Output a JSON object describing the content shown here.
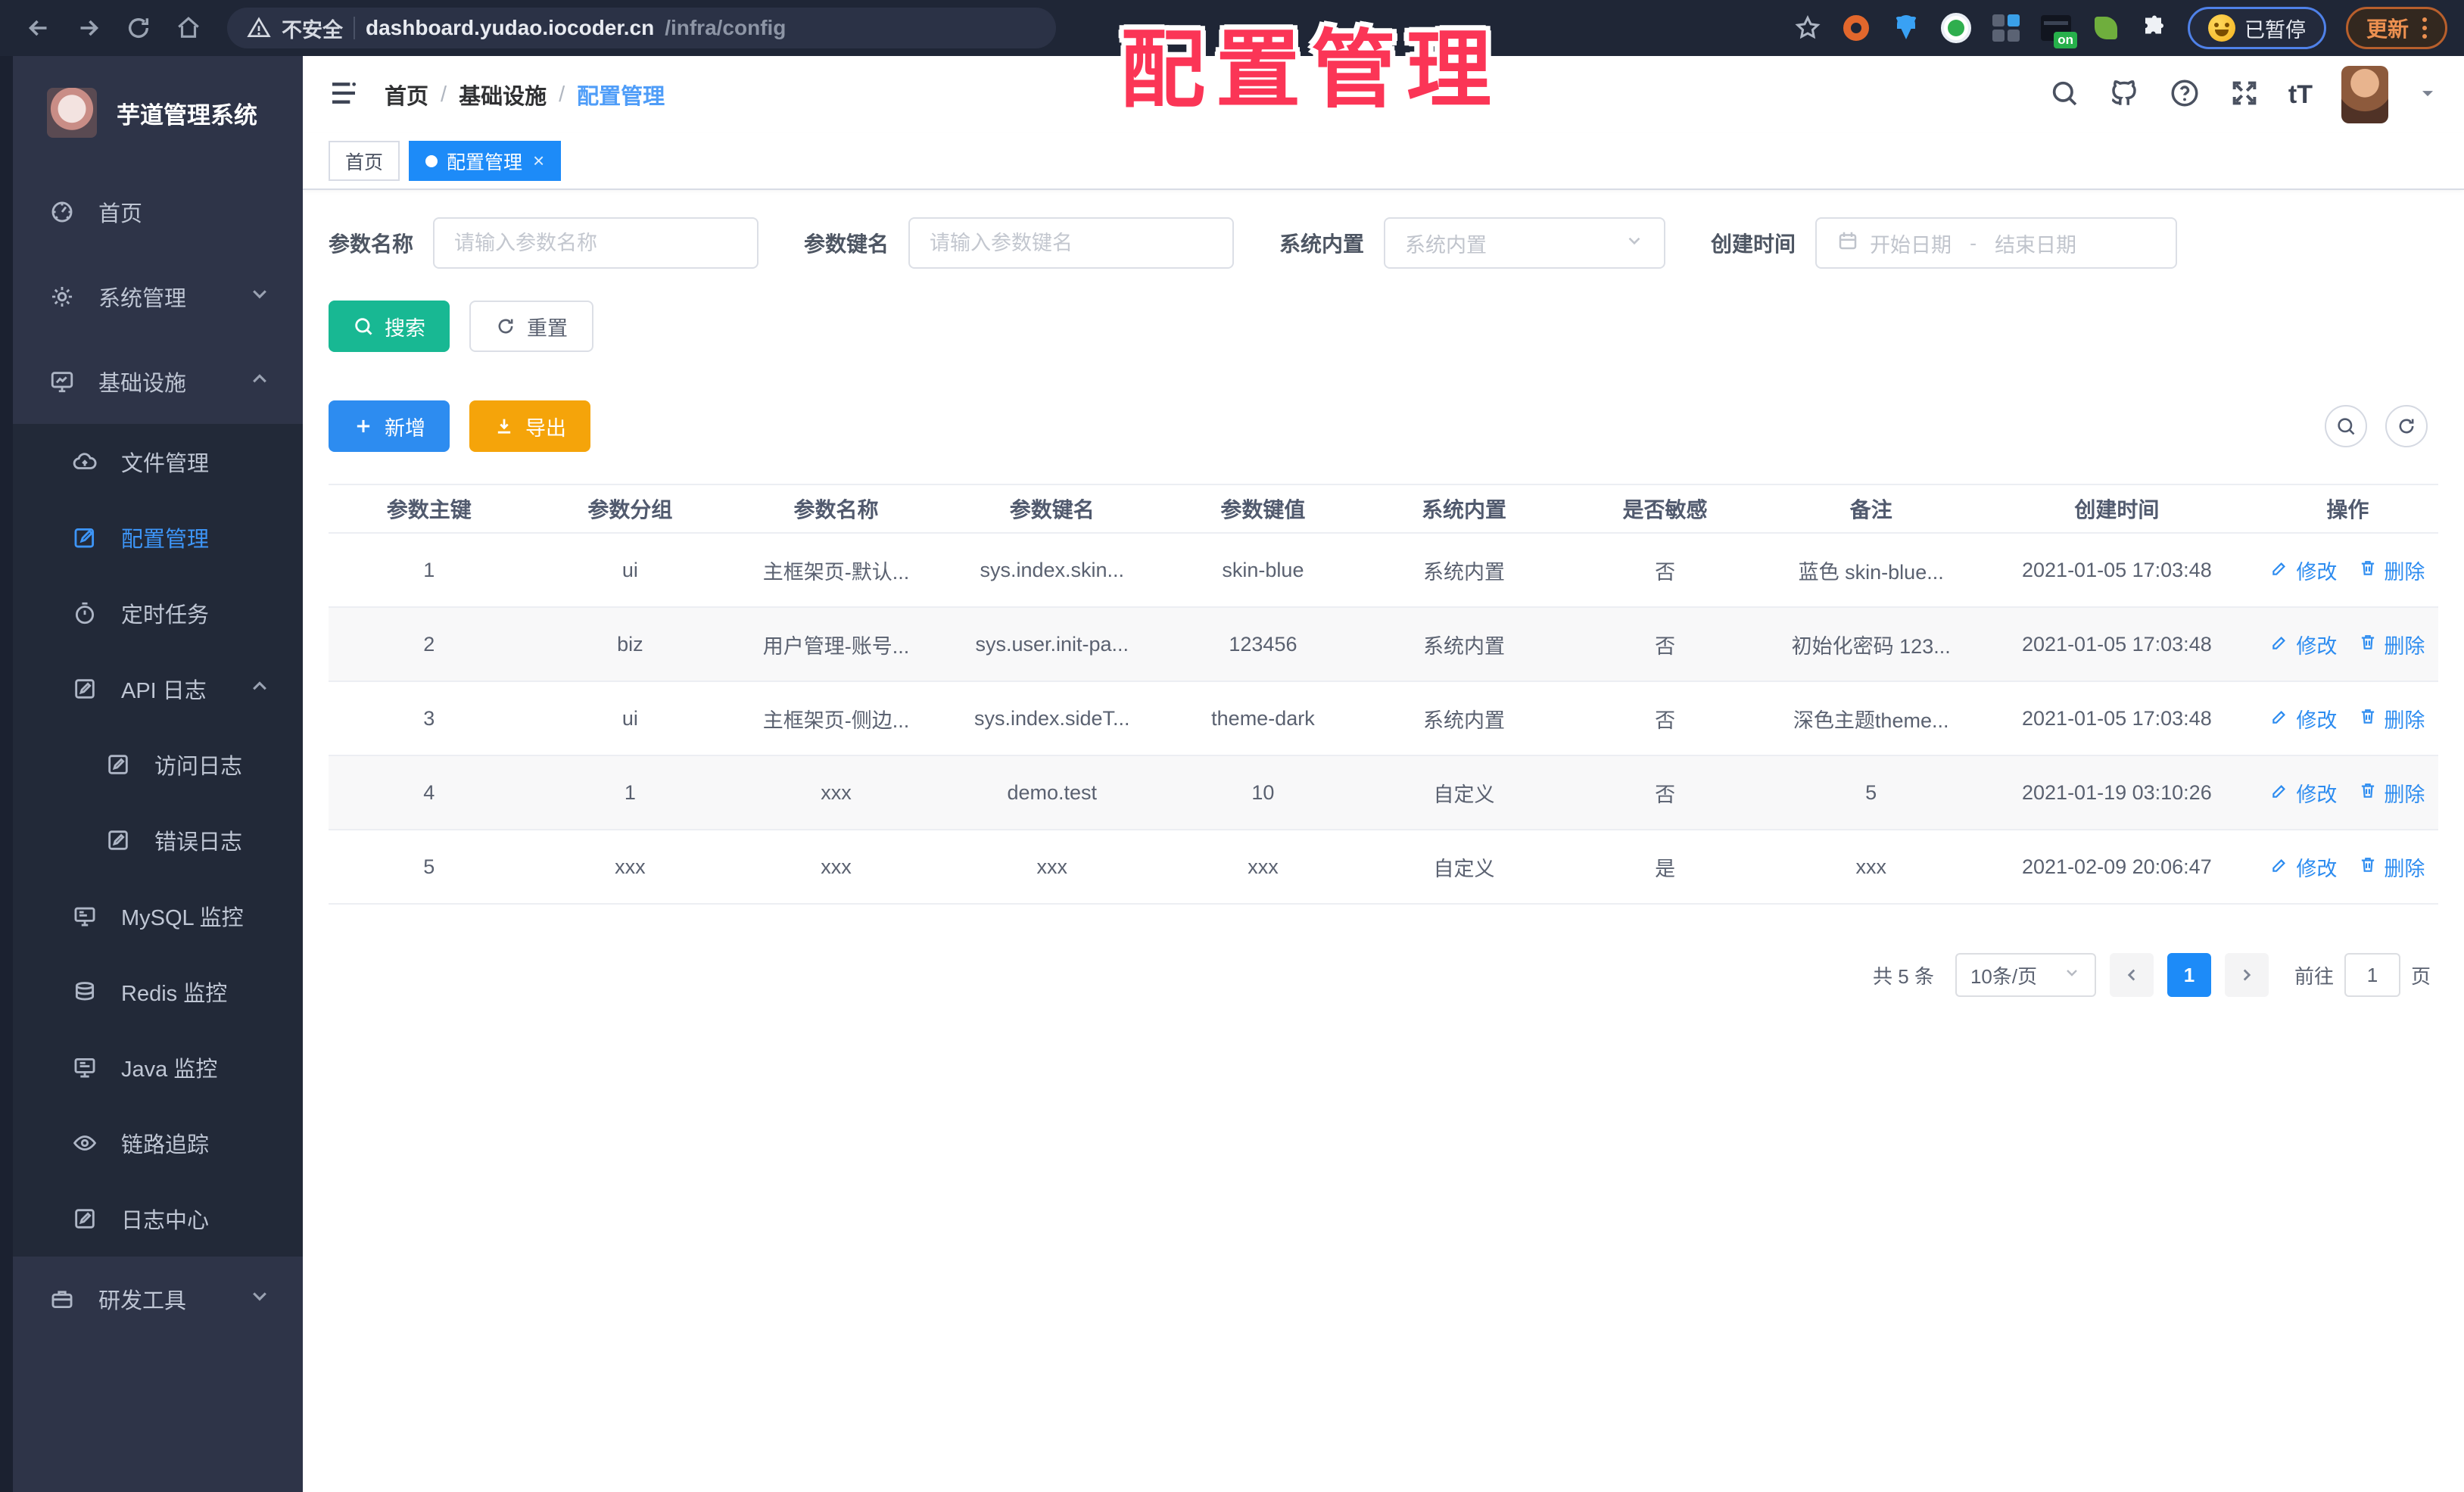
{
  "overlay": {
    "title": "配置管理"
  },
  "browser": {
    "security_label": "不安全",
    "url_host": "dashboard.yudao.iocoder.cn",
    "url_path": "/infra/config",
    "paused_label": "已暂停",
    "update_label": "更新",
    "extension_on_badge": "on"
  },
  "sidebar": {
    "logo_title": "芋道管理系统",
    "menu": [
      {
        "label": "首页",
        "icon": "dashboard-icon",
        "level": 1,
        "active": false,
        "chevron": null,
        "sub": false
      },
      {
        "label": "系统管理",
        "icon": "gear-icon",
        "level": 1,
        "active": false,
        "chevron": "down",
        "sub": false
      },
      {
        "label": "基础设施",
        "icon": "infra-icon",
        "level": 1,
        "active": false,
        "chevron": "up",
        "sub": false
      },
      {
        "label": "文件管理",
        "icon": "cloud-icon",
        "level": 2,
        "active": false,
        "chevron": null,
        "sub": true
      },
      {
        "label": "配置管理",
        "icon": "edit-icon",
        "level": 2,
        "active": true,
        "chevron": null,
        "sub": true
      },
      {
        "label": "定时任务",
        "icon": "timer-icon",
        "level": 2,
        "active": false,
        "chevron": null,
        "sub": true
      },
      {
        "label": "API 日志",
        "icon": "log-icon",
        "level": 2,
        "active": false,
        "chevron": "up",
        "sub": true
      },
      {
        "label": "访问日志",
        "icon": "log-icon",
        "level": 3,
        "active": false,
        "chevron": null,
        "sub": true
      },
      {
        "label": "错误日志",
        "icon": "log-icon",
        "level": 3,
        "active": false,
        "chevron": null,
        "sub": true
      },
      {
        "label": "MySQL 监控",
        "icon": "mysql-icon",
        "level": 2,
        "active": false,
        "chevron": null,
        "sub": true
      },
      {
        "label": "Redis 监控",
        "icon": "redis-icon",
        "level": 2,
        "active": false,
        "chevron": null,
        "sub": true
      },
      {
        "label": "Java 监控",
        "icon": "java-icon",
        "level": 2,
        "active": false,
        "chevron": null,
        "sub": true
      },
      {
        "label": "链路追踪",
        "icon": "eye-icon",
        "level": 2,
        "active": false,
        "chevron": null,
        "sub": true
      },
      {
        "label": "日志中心",
        "icon": "log-icon",
        "level": 2,
        "active": false,
        "chevron": null,
        "sub": true
      },
      {
        "label": "研发工具",
        "icon": "tools-icon",
        "level": 1,
        "active": false,
        "chevron": "down",
        "sub": false
      }
    ]
  },
  "header": {
    "breadcrumb": [
      "首页",
      "基础设施",
      "配置管理"
    ]
  },
  "tags": [
    {
      "label": "首页",
      "active": false,
      "closable": false
    },
    {
      "label": "配置管理",
      "active": true,
      "closable": true
    }
  ],
  "filters": {
    "name_label": "参数名称",
    "name_placeholder": "请输入参数名称",
    "key_label": "参数键名",
    "key_placeholder": "请输入参数键名",
    "type_label": "系统内置",
    "type_placeholder": "系统内置",
    "date_label": "创建时间",
    "date_start_placeholder": "开始日期",
    "date_separator": "-",
    "date_end_placeholder": "结束日期",
    "search_label": "搜索",
    "reset_label": "重置"
  },
  "toolbar": {
    "add_label": "新增",
    "export_label": "导出"
  },
  "table": {
    "columns": [
      "参数主键",
      "参数分组",
      "参数名称",
      "参数键名",
      "参数键值",
      "系统内置",
      "是否敏感",
      "备注",
      "创建时间",
      "操作"
    ],
    "edit_label": "修改",
    "delete_label": "删除",
    "rows": [
      {
        "id": "1",
        "group": "ui",
        "name": "主框架页-默认...",
        "key": "sys.index.skin...",
        "value": "skin-blue",
        "type": "系统内置",
        "sensitive": "否",
        "remark": "蓝色 skin-blue...",
        "created": "2021-01-05 17:03:48"
      },
      {
        "id": "2",
        "group": "biz",
        "name": "用户管理-账号...",
        "key": "sys.user.init-pa...",
        "value": "123456",
        "type": "系统内置",
        "sensitive": "否",
        "remark": "初始化密码 123...",
        "created": "2021-01-05 17:03:48"
      },
      {
        "id": "3",
        "group": "ui",
        "name": "主框架页-侧边...",
        "key": "sys.index.sideT...",
        "value": "theme-dark",
        "type": "系统内置",
        "sensitive": "否",
        "remark": "深色主题theme...",
        "created": "2021-01-05 17:03:48"
      },
      {
        "id": "4",
        "group": "1",
        "name": "xxx",
        "key": "demo.test",
        "value": "10",
        "type": "自定义",
        "sensitive": "否",
        "remark": "5",
        "created": "2021-01-19 03:10:26"
      },
      {
        "id": "5",
        "group": "xxx",
        "name": "xxx",
        "key": "xxx",
        "value": "xxx",
        "type": "自定义",
        "sensitive": "是",
        "remark": "xxx",
        "created": "2021-02-09 20:06:47"
      }
    ]
  },
  "pagination": {
    "total_label": "共 5 条",
    "page_size": "10条/页",
    "current_page": "1",
    "goto_label": "前往",
    "goto_value": "1",
    "page_label": "页"
  },
  "colors": {
    "accent": "#2d8cf0",
    "tag_active": "#1d8bf8",
    "success": "#18b893",
    "warning": "#f5a40a",
    "overlay_text": "#fb3556",
    "sidebar_bg": "#2e3448",
    "submenu_bg": "#222938"
  }
}
